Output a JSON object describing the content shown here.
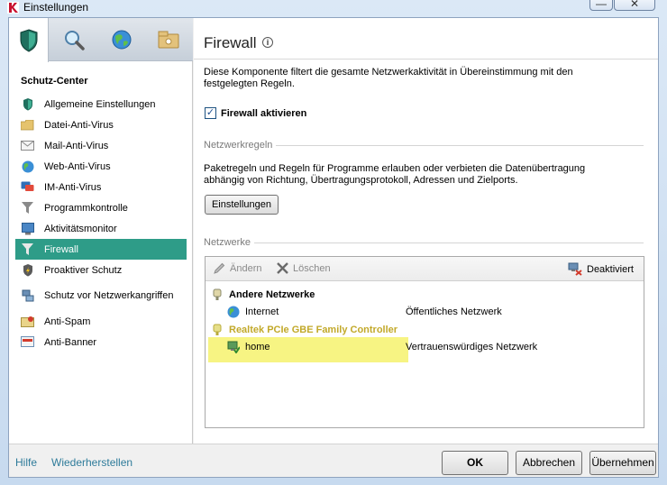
{
  "window": {
    "title": "Einstellungen",
    "minimize": "—",
    "close": "✕"
  },
  "sidebar": {
    "tabs": [
      {
        "name": "protection-tab-icon"
      },
      {
        "name": "search-tab-icon"
      },
      {
        "name": "update-tab-icon"
      },
      {
        "name": "settings-tab-icon"
      }
    ],
    "heading": "Schutz-Center",
    "items": [
      {
        "label": "Allgemeine Einstellungen",
        "icon": "shield-icon"
      },
      {
        "label": "Datei-Anti-Virus",
        "icon": "folder-icon"
      },
      {
        "label": "Mail-Anti-Virus",
        "icon": "mail-icon"
      },
      {
        "label": "Web-Anti-Virus",
        "icon": "globe-icon"
      },
      {
        "label": "IM-Anti-Virus",
        "icon": "chat-icon"
      },
      {
        "label": "Programmkontrolle",
        "icon": "filter-icon"
      },
      {
        "label": "Aktivitätsmonitor",
        "icon": "monitor-icon"
      },
      {
        "label": "Firewall",
        "icon": "firewall-icon"
      },
      {
        "label": "Proaktiver Schutz",
        "icon": "proactive-shield-icon"
      },
      {
        "label": "Schutz vor Netzwerkangriffen",
        "icon": "network-attack-icon"
      },
      {
        "label": "Anti-Spam",
        "icon": "anti-spam-icon"
      },
      {
        "label": "Anti-Banner",
        "icon": "anti-banner-icon"
      }
    ],
    "active_index": 7
  },
  "main": {
    "title": "Firewall",
    "info": "i",
    "description": "Diese Komponente filtert die gesamte Netzwerkaktivität in Übereinstimmung mit den festgelegten Regeln.",
    "enable_checkbox": {
      "label": "Firewall aktivieren",
      "checked": true,
      "mark": "✓"
    },
    "rules_group": {
      "title": "Netzwerkregeln",
      "description": "Paketregeln und Regeln für Programme erlauben oder verbieten die Datenübertragung abhängig von Richtung, Übertragungsprotokoll, Adressen und Zielports.",
      "settings_button": "Einstellungen"
    },
    "networks_group": {
      "title": "Netzwerke",
      "toolbar": {
        "edit": "Ändern",
        "delete": "Löschen",
        "disabled": "Deaktiviert"
      },
      "rows": [
        {
          "type": "group",
          "name": "Andere Netzwerke",
          "status": ""
        },
        {
          "type": "item",
          "name": "Internet",
          "status": "Öffentliches Netzwerk"
        },
        {
          "type": "adapter",
          "name": "Realtek PCIe GBE Family Controller",
          "status": ""
        },
        {
          "type": "item",
          "name": "home",
          "status": "Vertrauenswürdiges Netzwerk"
        }
      ]
    }
  },
  "footer": {
    "help": "Hilfe",
    "restore": "Wiederherstellen",
    "ok": "OK",
    "cancel": "Abbrechen",
    "apply": "Übernehmen"
  },
  "colors": {
    "active_nav": "#2e9c88",
    "link": "#2e7b9a",
    "highlight": "#f4f05a"
  }
}
